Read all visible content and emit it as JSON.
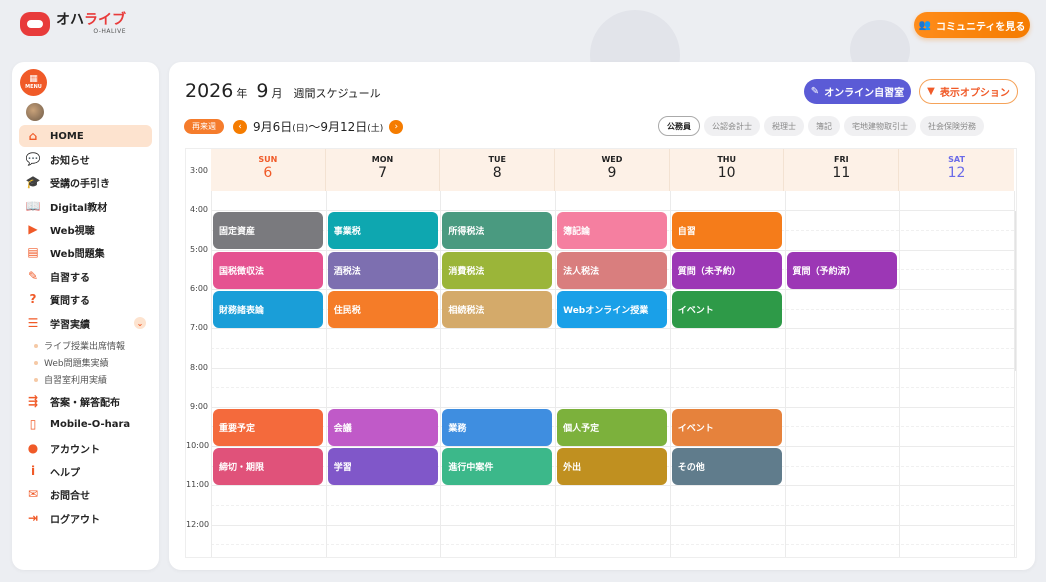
{
  "header": {
    "logo_main": "オハ",
    "logo_accent": "ライブ",
    "logo_sub": "O-HALIVE",
    "community_button": "コミュニティを見る"
  },
  "sidebar": {
    "menu_label": "MENU",
    "items": [
      {
        "label": "HOME",
        "icon": "home-icon",
        "active": true
      },
      {
        "label": "お知らせ",
        "icon": "chat-icon"
      },
      {
        "label": "受講の手引き",
        "icon": "graduation-cap-icon"
      },
      {
        "label": "Digital教材",
        "icon": "book-icon"
      },
      {
        "label": "Web視聴",
        "icon": "play-icon"
      },
      {
        "label": "Web問題集",
        "icon": "document-icon"
      },
      {
        "label": "自習する",
        "icon": "pencil-icon"
      },
      {
        "label": "質問する",
        "icon": "question-icon"
      },
      {
        "label": "学習実績",
        "icon": "list-icon"
      },
      {
        "label": "答案・解答配布",
        "icon": "distribution-icon"
      },
      {
        "label": "Mobile-O-hara",
        "icon": "mobile-icon"
      },
      {
        "label": "アカウント",
        "icon": "account-icon"
      },
      {
        "label": "ヘルプ",
        "icon": "info-icon"
      },
      {
        "label": "お問合せ",
        "icon": "mail-icon"
      },
      {
        "label": "ログアウト",
        "icon": "logout-icon"
      }
    ],
    "subitems": [
      "ライブ授業出席情報",
      "Web問題集実績",
      "自習室利用実績"
    ]
  },
  "main": {
    "year": "2026",
    "year_unit": "年",
    "month": "9",
    "month_unit": "月",
    "schedule_label": "週間スケジュール",
    "online_button": "オンライン自習室",
    "display_button": "表示オプション",
    "next_week": "再来週",
    "range_start": "9月6日",
    "range_start_dow": "(日)",
    "range_sep": "～",
    "range_end": "9月12日",
    "range_end_dow": "(土)",
    "filters": [
      "公務員",
      "公認会計士",
      "税理士",
      "簿記",
      "宅地建物取引士",
      "社会保険労務"
    ]
  },
  "calendar": {
    "days": [
      {
        "name": "SUN",
        "date": "6",
        "color": "#f05a28"
      },
      {
        "name": "MON",
        "date": "7",
        "color": "#222222"
      },
      {
        "name": "TUE",
        "date": "8",
        "color": "#222222"
      },
      {
        "name": "WED",
        "date": "9",
        "color": "#222222"
      },
      {
        "name": "THU",
        "date": "10",
        "color": "#222222"
      },
      {
        "name": "FRI",
        "date": "11",
        "color": "#222222"
      },
      {
        "name": "SAT",
        "date": "12",
        "color": "#6a6ae8"
      }
    ],
    "times": [
      "3:00",
      "4:00",
      "5:00",
      "6:00",
      "7:00",
      "8:00",
      "9:00",
      "10:00",
      "11:00",
      "12:00"
    ],
    "events": [
      {
        "label": "固定資産",
        "day": 0,
        "row": 0,
        "color": "#7a7a7e"
      },
      {
        "label": "事業税",
        "day": 1,
        "row": 0,
        "color": "#0ea7b0"
      },
      {
        "label": "所得税法",
        "day": 2,
        "row": 0,
        "color": "#4a9a80"
      },
      {
        "label": "簿記論",
        "day": 3,
        "row": 0,
        "color": "#f57fa0"
      },
      {
        "label": "自習",
        "day": 4,
        "row": 0,
        "color": "#f57c1a"
      },
      {
        "label": "国税徴収法",
        "day": 0,
        "row": 1,
        "color": "#e55391"
      },
      {
        "label": "酒税法",
        "day": 1,
        "row": 1,
        "color": "#7d6fb0"
      },
      {
        "label": "消費税法",
        "day": 2,
        "row": 1,
        "color": "#9bb539"
      },
      {
        "label": "法人税法",
        "day": 3,
        "row": 1,
        "color": "#d97e7e"
      },
      {
        "label": "質問（未予約）",
        "day": 4,
        "row": 1,
        "color": "#9c37b5"
      },
      {
        "label": "質問（予約済）",
        "day": 5,
        "row": 1,
        "color": "#9c37b5"
      },
      {
        "label": "財務諸表論",
        "day": 0,
        "row": 2,
        "color": "#1a9ed8"
      },
      {
        "label": "住民税",
        "day": 1,
        "row": 2,
        "color": "#f57c28"
      },
      {
        "label": "相続税法",
        "day": 2,
        "row": 2,
        "color": "#d4aa6a"
      },
      {
        "label": "Webオンライン授業",
        "day": 3,
        "row": 2,
        "color": "#1aa0e8"
      },
      {
        "label": "イベント",
        "day": 4,
        "row": 2,
        "color": "#2e9a48"
      },
      {
        "label": "重要予定",
        "day": 0,
        "row": 3,
        "color": "#f46a3c"
      },
      {
        "label": "会議",
        "day": 1,
        "row": 3,
        "color": "#c05ac8"
      },
      {
        "label": "業務",
        "day": 2,
        "row": 3,
        "color": "#3f8ee0"
      },
      {
        "label": "個人予定",
        "day": 3,
        "row": 3,
        "color": "#7cb13c"
      },
      {
        "label": "イベント",
        "day": 4,
        "row": 3,
        "color": "#e6823c"
      },
      {
        "label": "締切・期限",
        "day": 0,
        "row": 4,
        "color": "#e0527a"
      },
      {
        "label": "学習",
        "day": 1,
        "row": 4,
        "color": "#8057c9"
      },
      {
        "label": "進行中案件",
        "day": 2,
        "row": 4,
        "color": "#3cb88a"
      },
      {
        "label": "外出",
        "day": 3,
        "row": 4,
        "color": "#c09020"
      },
      {
        "label": "その他",
        "day": 4,
        "row": 4,
        "color": "#607c8c"
      }
    ]
  }
}
